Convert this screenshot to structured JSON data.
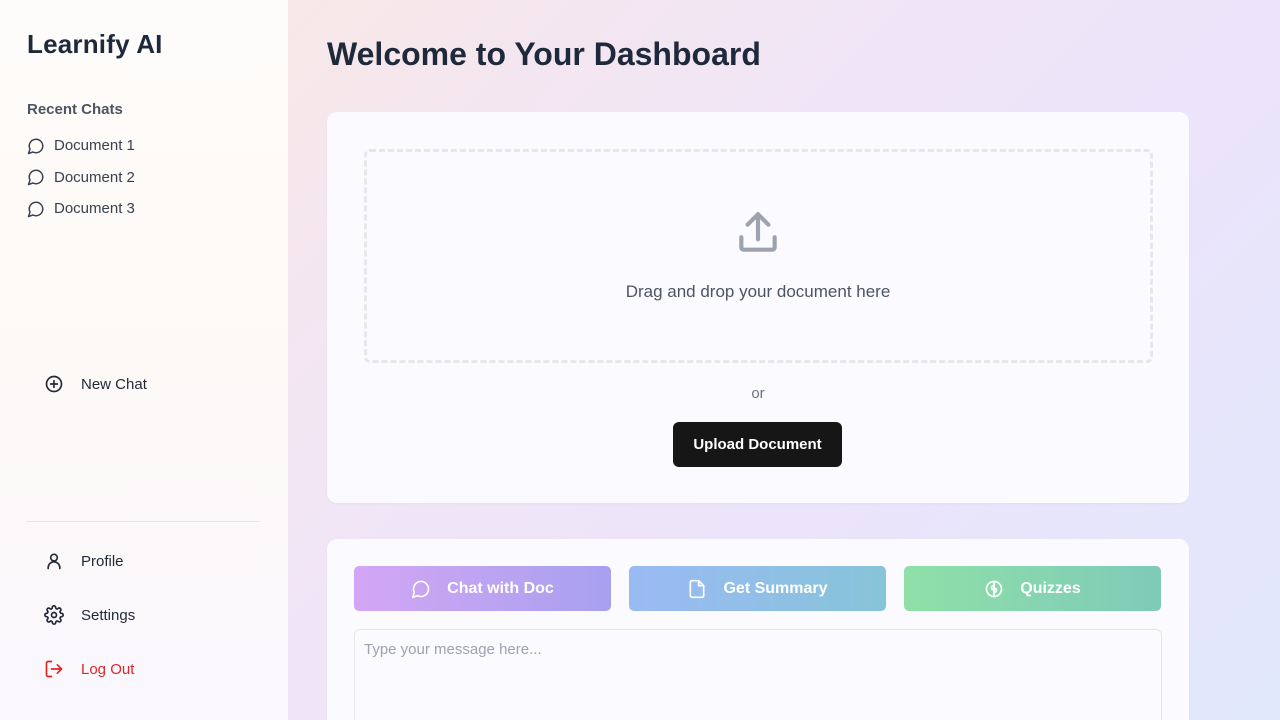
{
  "sidebar": {
    "brand": "Learnify AI",
    "recent_heading": "Recent Chats",
    "recent_items": [
      {
        "label": "Document 1",
        "icon": "chat-bubble-icon"
      },
      {
        "label": "Document 2",
        "icon": "chat-bubble-icon"
      },
      {
        "label": "Document 3",
        "icon": "chat-bubble-icon"
      }
    ],
    "new_chat": {
      "label": "New Chat",
      "icon": "plus-circle-icon"
    },
    "bottom_items": [
      {
        "label": "Profile",
        "icon": "user-icon"
      },
      {
        "label": "Settings",
        "icon": "gear-icon"
      },
      {
        "label": "Log Out",
        "icon": "logout-icon",
        "color": "#dc2626"
      }
    ]
  },
  "main": {
    "title": "Welcome to Your Dashboard",
    "upload": {
      "icon": "upload-icon",
      "drop_text": "Drag and drop your document here",
      "or_text": "or",
      "button_label": "Upload Document"
    },
    "modes": [
      {
        "label": "Chat with Doc",
        "icon": "chat-bubble-icon",
        "color": "#c0a3f2"
      },
      {
        "label": "Get Summary",
        "icon": "document-icon",
        "color": "#90bfe6"
      },
      {
        "label": "Quizzes",
        "icon": "brain-icon",
        "color": "#87d6b0"
      }
    ],
    "message": {
      "placeholder": "Type your message here...",
      "value": ""
    }
  },
  "colors": {
    "accent_dark": "#161616",
    "danger": "#dc2626",
    "title": "#1e2a3b"
  }
}
